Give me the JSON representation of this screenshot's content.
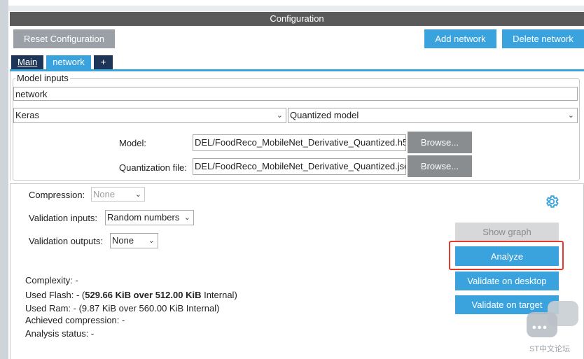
{
  "header": {
    "title": "Configuration"
  },
  "toolbar": {
    "reset_label": "Reset Configuration",
    "add_network_label": "Add network",
    "delete_network_label": "Delete network"
  },
  "tabs": [
    {
      "label": "Main"
    },
    {
      "label": "network"
    },
    {
      "label": "+"
    }
  ],
  "model_inputs": {
    "legend": "Model inputs",
    "network_name": "network",
    "framework": "Keras",
    "model_type": "Quantized model",
    "model_label": "Model:",
    "model_path": "DEL/FoodReco_MobileNet_Derivative_Quantized.h5",
    "quant_label": "Quantization file:",
    "quant_path": "DEL/FoodReco_MobileNet_Derivative_Quantized.json",
    "browse_label": "Browse..."
  },
  "settings": {
    "compression_label": "Compression:",
    "compression_value": "None",
    "validation_inputs_label": "Validation inputs:",
    "validation_inputs_value": "Random numbers",
    "validation_outputs_label": "Validation outputs:",
    "validation_outputs_value": "None"
  },
  "actions": {
    "show_graph": "Show graph",
    "analyze": "Analyze",
    "validate_desktop": "Validate on desktop",
    "validate_target": "Validate on target"
  },
  "stats": {
    "complexity": "Complexity: -",
    "used_flash_prefix": "Used Flash: - (",
    "used_flash_bold": "529.66 KiB over 512.00 KiB",
    "used_flash_suffix": " Internal)",
    "used_ram": "Used Ram: - (9.87 KiB over 560.00 KiB Internal)",
    "achieved_compression": "Achieved compression: -",
    "analysis_status": "Analysis status: -"
  },
  "watermark": {
    "text": "ST中文论坛",
    "dots": "•••"
  },
  "icons": {
    "gear": "gear-icon",
    "chevron": "chevron-down-icon"
  },
  "colors": {
    "accent": "#3aa3de",
    "highlight": "#e23a2a",
    "header_bg": "#5a5a5a"
  }
}
